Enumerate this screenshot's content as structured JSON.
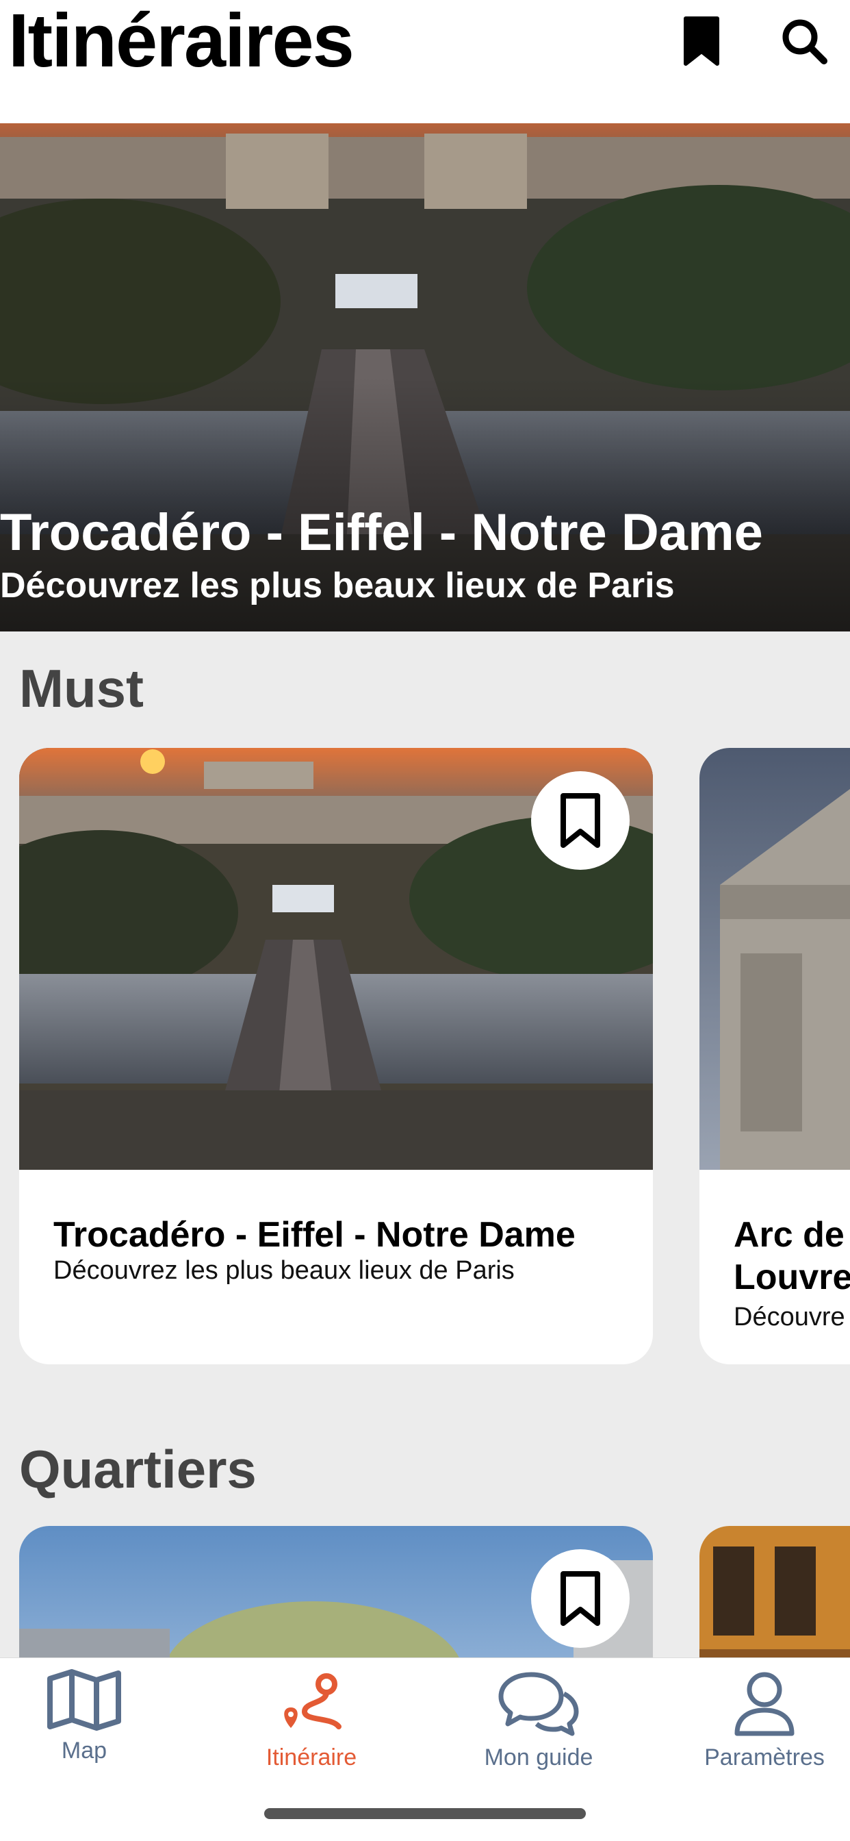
{
  "header": {
    "title": "Itinéraires",
    "bookmark_icon": "bookmark-icon",
    "search_icon": "search-icon"
  },
  "hero": {
    "title": "Trocadéro - Eiffel - Notre Dame",
    "subtitle": "Découvrez les plus beaux lieux de Paris"
  },
  "sections": {
    "must": {
      "title": "Must",
      "cards": [
        {
          "title": "Trocadéro - Eiffel - Notre Dame",
          "subtitle": "Découvrez les plus beaux lieux de Paris"
        },
        {
          "title_line1": "Arc de",
          "title_line2": "Louvre",
          "subtitle": "Découvre"
        }
      ]
    },
    "quartiers": {
      "title": "Quartiers"
    }
  },
  "tabbar": {
    "tabs": [
      {
        "label": "Map",
        "icon": "map-icon"
      },
      {
        "label": "Itinéraire",
        "icon": "route-icon",
        "active": true
      },
      {
        "label": "Mon guide",
        "icon": "chat-bubbles-icon"
      },
      {
        "label": "Paramètres",
        "icon": "user-icon"
      }
    ]
  },
  "colors": {
    "accent": "#e35a34",
    "tab_inactive": "#5a6f8c",
    "background": "#ececec"
  }
}
